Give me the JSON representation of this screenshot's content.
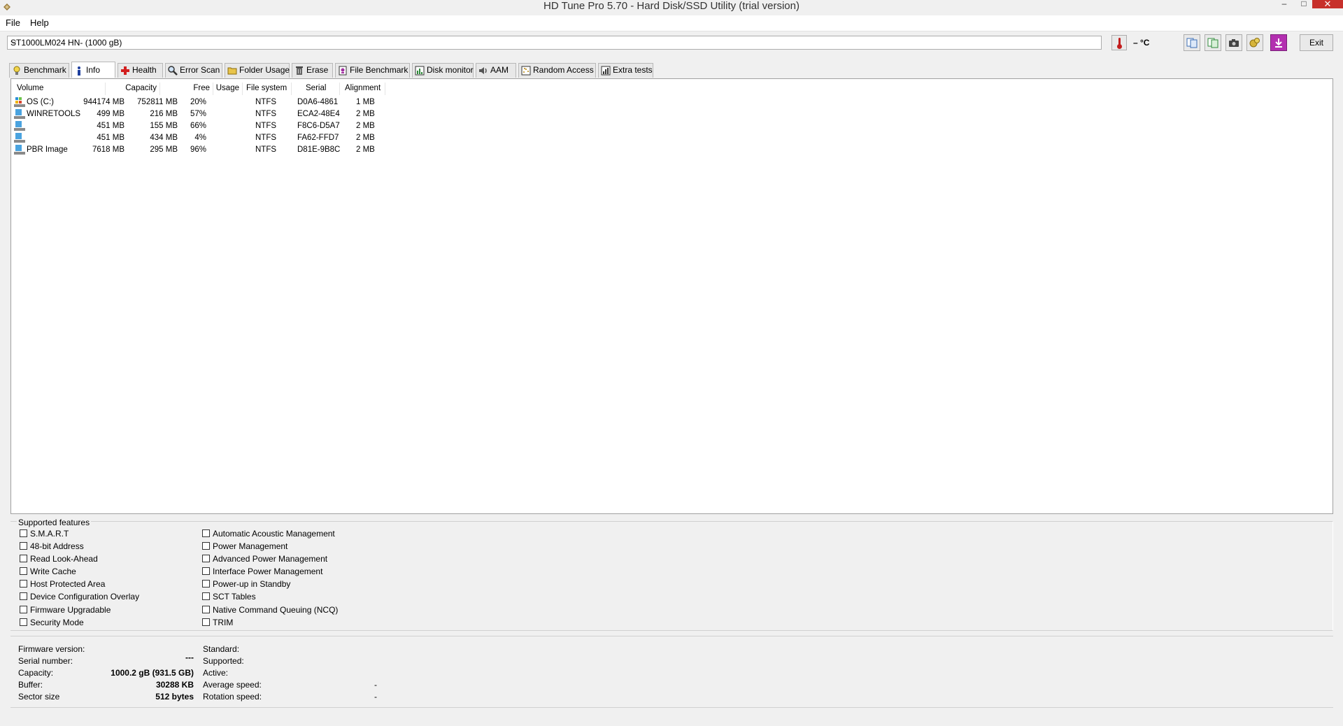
{
  "window": {
    "title": "HD Tune Pro 5.70 - Hard Disk/SSD Utility (trial version)",
    "minimize": "–",
    "maximize": "□",
    "close": "✕"
  },
  "menu": {
    "file": "File",
    "help": "Help"
  },
  "toolbar": {
    "drive": "ST1000LM024 HN- (1000 gB)",
    "temperature": "– °C",
    "exit": "Exit"
  },
  "tabs": [
    {
      "label": "Benchmark",
      "icon": "lightbulb-icon"
    },
    {
      "label": "Info",
      "icon": "info-icon"
    },
    {
      "label": "Health",
      "icon": "health-cross-icon"
    },
    {
      "label": "Error Scan",
      "icon": "magnifier-icon"
    },
    {
      "label": "Folder Usage",
      "icon": "folder-icon"
    },
    {
      "label": "Erase",
      "icon": "trash-icon"
    },
    {
      "label": "File Benchmark",
      "icon": "file-benchmark-icon"
    },
    {
      "label": "Disk monitor",
      "icon": "disk-monitor-icon"
    },
    {
      "label": "AAM",
      "icon": "speaker-icon"
    },
    {
      "label": "Random Access",
      "icon": "random-access-icon"
    },
    {
      "label": "Extra tests",
      "icon": "extra-tests-icon"
    }
  ],
  "volumes": {
    "columns": [
      "Volume",
      "Capacity",
      "Free",
      "Usage",
      "File system",
      "Serial",
      "Alignment"
    ],
    "rows": [
      {
        "volume": "OS (C:)",
        "capacity": "944174 MB",
        "free": "752811 MB",
        "usage": "20%",
        "fs": "NTFS",
        "serial": "D0A6-4861",
        "alignment": "1 MB"
      },
      {
        "volume": "WINRETOOLS",
        "capacity": "499 MB",
        "free": "216 MB",
        "usage": "57%",
        "fs": "NTFS",
        "serial": "ECA2-48E4",
        "alignment": "2 MB"
      },
      {
        "volume": "",
        "capacity": "451 MB",
        "free": "155 MB",
        "usage": "66%",
        "fs": "NTFS",
        "serial": "F8C6-D5A7",
        "alignment": "2 MB"
      },
      {
        "volume": "",
        "capacity": "451 MB",
        "free": "434 MB",
        "usage": "4%",
        "fs": "NTFS",
        "serial": "FA62-FFD7",
        "alignment": "2 MB"
      },
      {
        "volume": "PBR Image",
        "capacity": "7618 MB",
        "free": "295 MB",
        "usage": "96%",
        "fs": "NTFS",
        "serial": "D81E-9B8C",
        "alignment": "2 MB"
      }
    ]
  },
  "features": {
    "legend": "Supported features",
    "left": [
      "S.M.A.R.T",
      "48-bit Address",
      "Read Look-Ahead",
      "Write Cache",
      "Host Protected Area",
      "Device Configuration Overlay",
      "Firmware Upgradable",
      "Security Mode"
    ],
    "right": [
      "Automatic Acoustic Management",
      "Power Management",
      "Advanced Power Management",
      "Interface Power Management",
      "Power-up in Standby",
      "SCT Tables",
      "Native Command Queuing (NCQ)",
      "TRIM"
    ]
  },
  "info": {
    "firmware_label": "Firmware version:",
    "firmware_value": "",
    "serial_label": "Serial number:",
    "serial_value": "---",
    "capacity_label": "Capacity:",
    "capacity_value": "1000.2 gB (931.5 GB)",
    "buffer_label": "Buffer:",
    "buffer_value": "30288 KB",
    "sector_label": "Sector size",
    "sector_value": "512 bytes",
    "standard_label": "Standard:",
    "supported_label": "Supported:",
    "active_label": "Active:",
    "avg_speed_label": "Average speed:",
    "avg_speed_value": "-",
    "rotation_label": "Rotation speed:",
    "rotation_value": "-"
  }
}
